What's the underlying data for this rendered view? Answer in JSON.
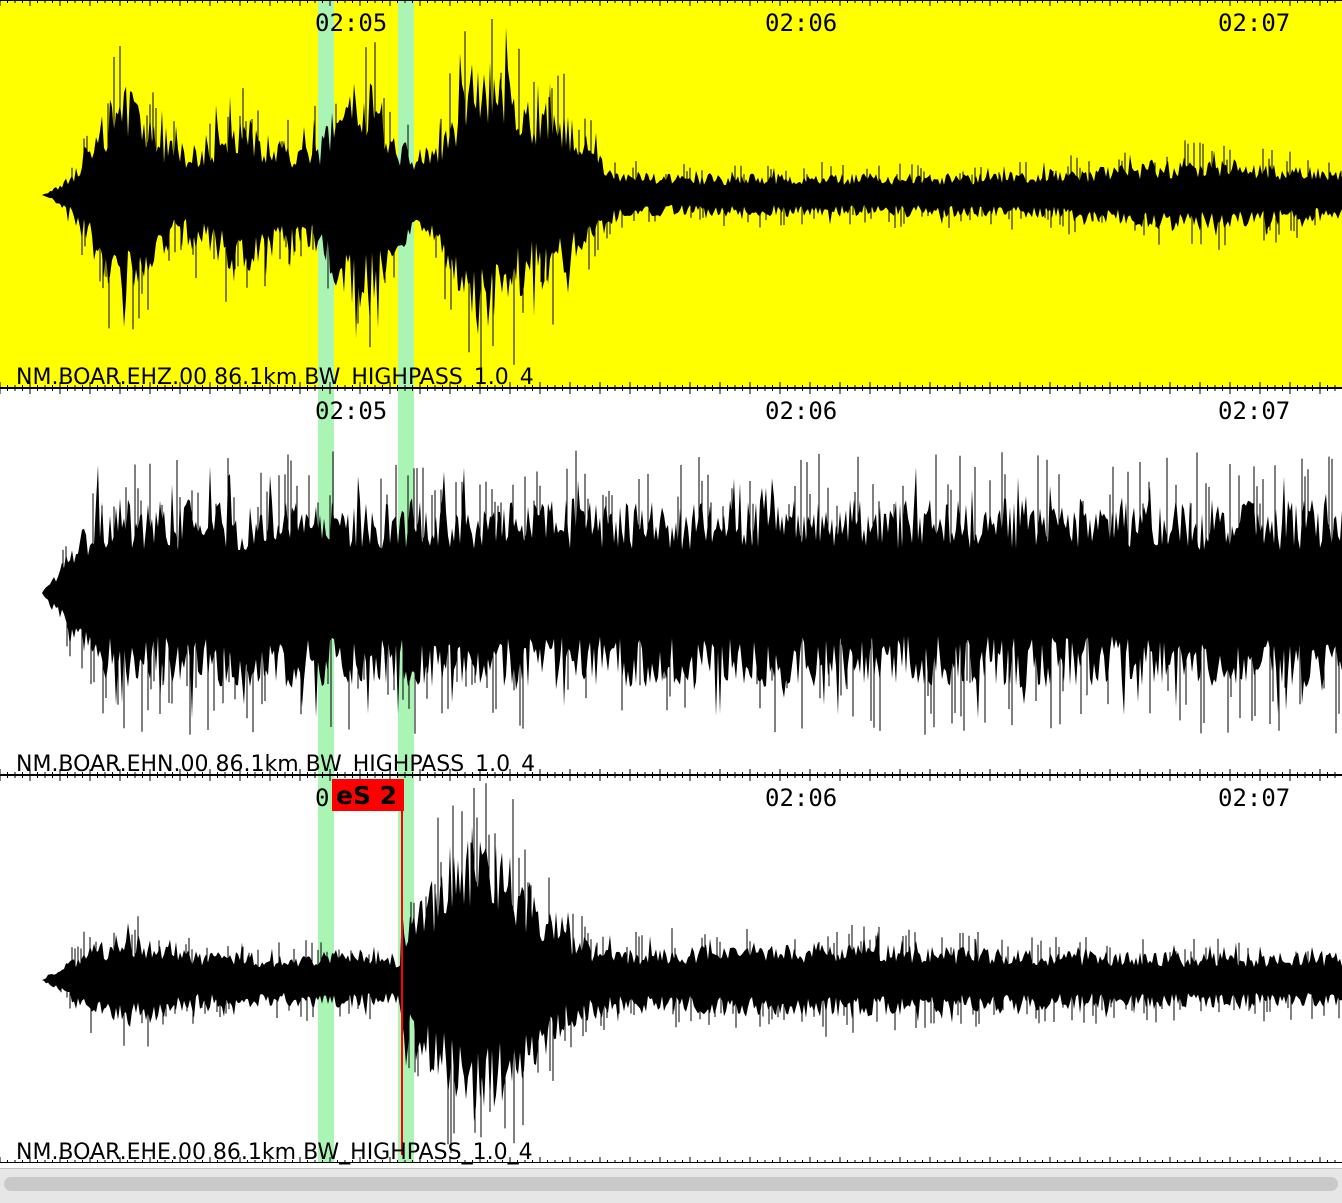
{
  "colors": {
    "selected_background": "#ffff00",
    "background": "#ffffff",
    "trace": "#000000",
    "window_highlight": "#aaf5b4",
    "pick": "#ff0000",
    "label_highlight": "#9ff0f0"
  },
  "traces": [
    {
      "label": "NM.BOAR.EHZ.00 86.1km BW_HIGHPASS_1.0_4",
      "selected": true,
      "time_ticks": [
        "02:05",
        "02:06",
        "02:07"
      ]
    },
    {
      "label": "NM.BOAR.EHN.00 86.1km BW_HIGHPASS_1.0_4",
      "selected": false,
      "time_ticks": [
        "02:05",
        "02:06",
        "02:07"
      ]
    },
    {
      "label": "NM.BOAR.EHE.00 86.1km BW_HIGHPASS_1.0_4",
      "selected": false,
      "time_ticks": [
        "0",
        "02:06",
        "02:07"
      ],
      "pick": {
        "label": "eS 2"
      }
    }
  ]
}
